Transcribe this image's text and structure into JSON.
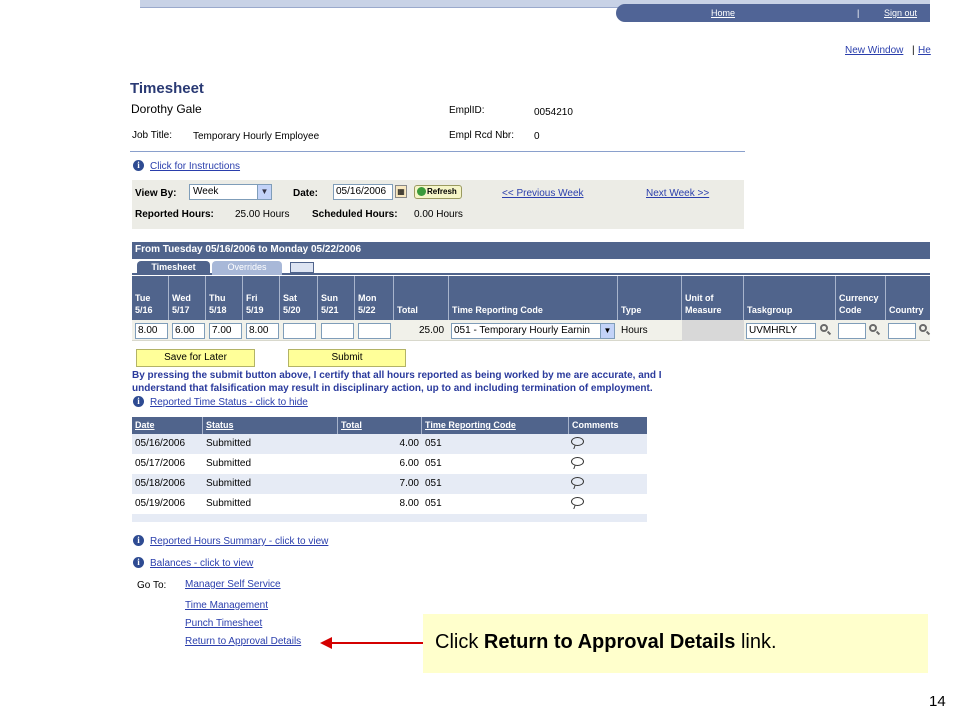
{
  "header": {
    "home": "Home",
    "signout": "Sign out",
    "new_window": "New Window",
    "help": "He"
  },
  "page": {
    "title": "Timesheet",
    "employee_name": "Dorothy Gale"
  },
  "employee": {
    "job_title_label": "Job Title:",
    "job_title": "Temporary Hourly Employee",
    "emplid_label": "EmplID:",
    "emplid": "0054210",
    "rcd_label": "Empl Rcd Nbr:",
    "rcd": "0"
  },
  "instructions_link": "Click for Instructions",
  "view": {
    "view_by_label": "View By:",
    "view_by": "Week",
    "date_label": "Date:",
    "date": "05/16/2006",
    "refresh": "Refresh",
    "prev": "<< Previous Week",
    "next": "Next Week >>",
    "reported_label": "Reported Hours:",
    "reported": "25.00 Hours",
    "scheduled_label": "Scheduled Hours:",
    "scheduled": "0.00 Hours"
  },
  "period": "From Tuesday 05/16/2006 to Monday 05/22/2006",
  "tabs": [
    "Timesheet",
    "Overrides"
  ],
  "grid": {
    "headers": [
      [
        "Tue",
        "5/16"
      ],
      [
        "Wed",
        "5/17"
      ],
      [
        "Thu",
        "5/18"
      ],
      [
        "Fri",
        "5/19"
      ],
      [
        "Sat",
        "5/20"
      ],
      [
        "Sun",
        "5/21"
      ],
      [
        "Mon",
        "5/22"
      ],
      [
        "Total",
        ""
      ],
      [
        "Time Reporting Code",
        ""
      ],
      [
        "Type",
        ""
      ],
      [
        "Unit of",
        "Measure"
      ],
      [
        "Taskgroup",
        ""
      ],
      [
        "Currency",
        "Code"
      ],
      [
        "Country",
        ""
      ]
    ],
    "row": {
      "days": [
        "8.00",
        "6.00",
        "7.00",
        "8.00",
        "",
        "",
        ""
      ],
      "total": "25.00",
      "trc": "051 - Temporary Hourly Earnin",
      "type": "Hours",
      "taskgroup": "UVMHRLY"
    }
  },
  "buttons": {
    "save_later": "Save for Later",
    "submit": "Submit"
  },
  "certify_text": "By pressing the submit button above, I certify that all hours reported as being worked by me are accurate, and I understand that falsification may result in disciplinary action, up to and including termination of employment.",
  "status_link": "Reported Time Status - click to hide",
  "status_table": {
    "headers": [
      "Date",
      "Status",
      "Total",
      "Time Reporting Code",
      "Comments"
    ],
    "rows": [
      [
        "05/16/2006",
        "Submitted",
        "4.00",
        "051"
      ],
      [
        "05/17/2006",
        "Submitted",
        "6.00",
        "051"
      ],
      [
        "05/18/2006",
        "Submitted",
        "7.00",
        "051"
      ],
      [
        "05/19/2006",
        "Submitted",
        "8.00",
        "051"
      ]
    ]
  },
  "summary_link": "Reported Hours Summary - click to view",
  "balances_link": "Balances - click to view",
  "goto": {
    "label": "Go To:",
    "links": [
      "Manager Self Service",
      "Time Management",
      "Punch Timesheet",
      "Return to Approval Details"
    ]
  },
  "callout": {
    "prefix": "Click ",
    "bold": "Return to Approval Details",
    "suffix": " link."
  },
  "page_number": "14",
  "colors": {
    "header": "#50648c",
    "link": "#2a3eac",
    "callout": "#ffffcc",
    "arrow": "#d40000",
    "button": "#ffff99"
  }
}
